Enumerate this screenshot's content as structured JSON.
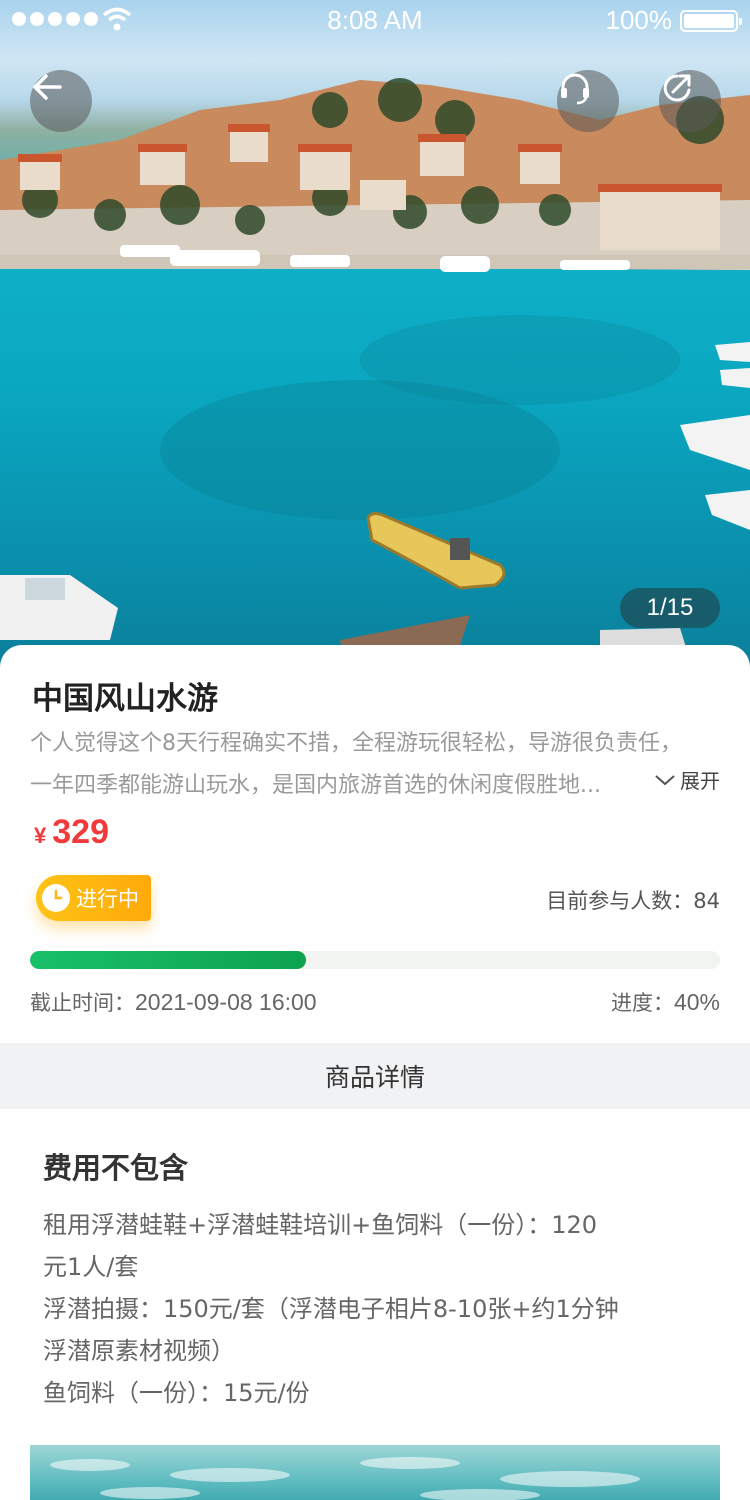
{
  "status_bar": {
    "time": "8:08 AM",
    "battery": "100%"
  },
  "hero": {
    "image_counter": "1/15"
  },
  "product": {
    "title": "中国风山水游",
    "description_line1": "个人觉得这个8天行程确实不措，全程游玩很轻松，导游很负责任，",
    "description_line2": "一年四季都能游山玩水，是国内旅游首选的休闲度假胜地...",
    "expand_label": "展开",
    "currency": "¥",
    "price": "329",
    "status": "进行中",
    "participants_label": "目前参与人数：",
    "participants_count": "84",
    "deadline_label": "截止时间：",
    "deadline_value": "2021-09-08 16:00",
    "progress_label": "进度：",
    "progress_value": "40%",
    "progress_fraction": 0.4
  },
  "details": {
    "section_title": "商品详情",
    "fee_title": "费用不包含",
    "fee_lines": [
      "租用浮潜蛙鞋+浮潜蛙鞋培训+鱼饲料（一份）：120",
      "元1人/套",
      "浮潜拍摄：150元/套（浮潜电子相片8-10张+约1分钟",
      "浮潜原素材视频）",
      "鱼饲料（一份）：15元/份"
    ]
  },
  "colors": {
    "price": "#f23a3a",
    "status_badge": "#ffb80f",
    "progress": "#14b45e",
    "section_bg": "#f1f2f4"
  },
  "icons": [
    "back-arrow-icon",
    "customer-service-icon",
    "share-icon",
    "chevron-down-icon",
    "clock-icon"
  ]
}
